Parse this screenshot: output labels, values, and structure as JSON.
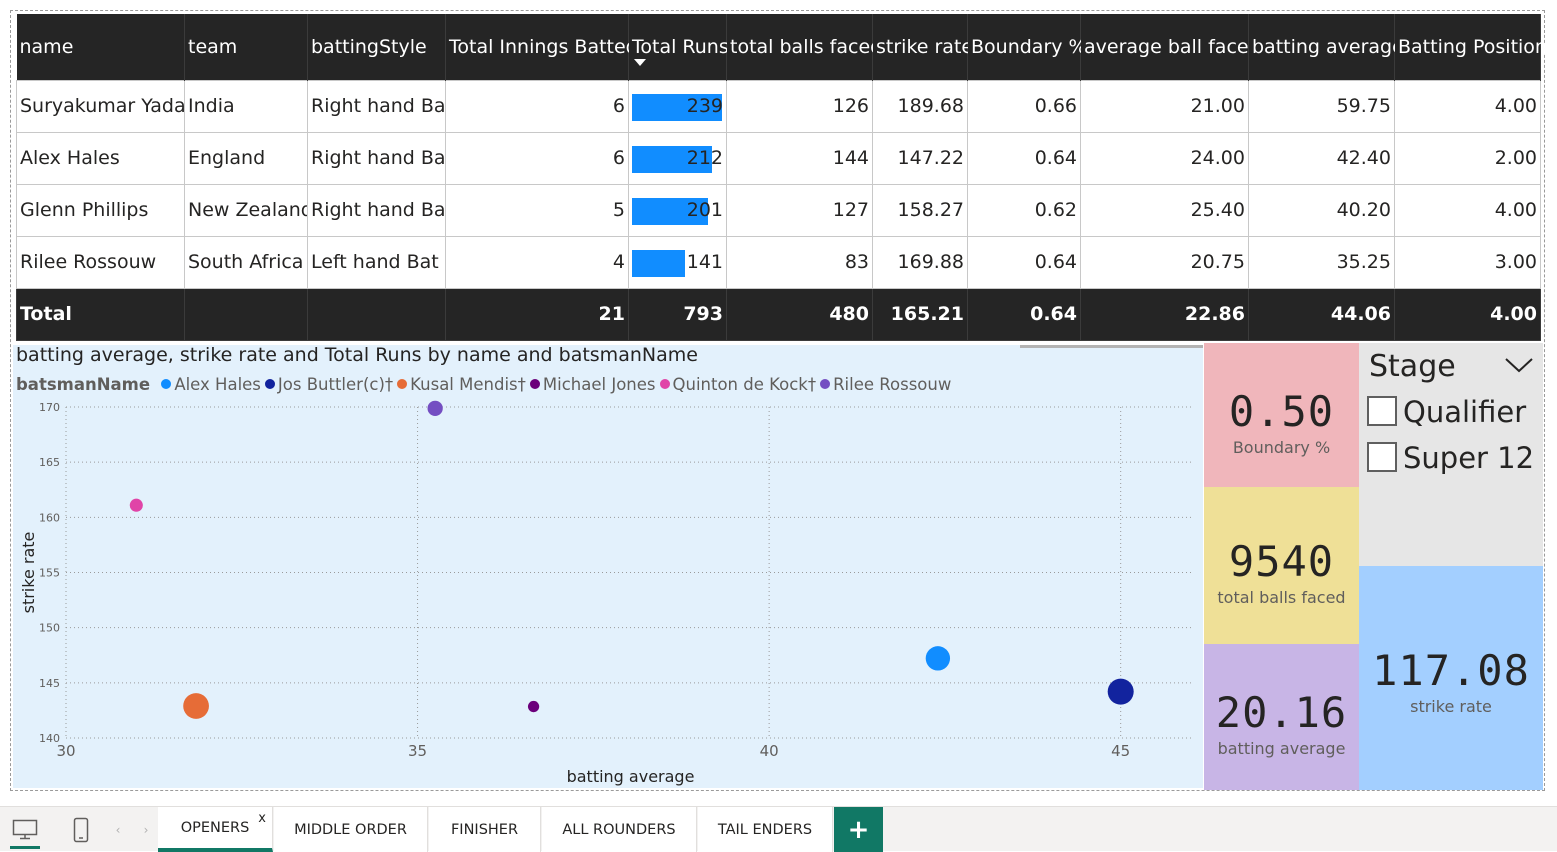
{
  "table": {
    "columns": [
      "name",
      "team",
      "battingStyle",
      "Total Innings Batted",
      "Total Runs",
      "total balls faced",
      "strike rate",
      "Boundary %",
      "average ball faced",
      "batting average",
      "Batting Position"
    ],
    "rows": [
      {
        "name": "Suryakumar Yadav",
        "team": "India",
        "style": "Right hand Bat",
        "innings": "6",
        "runs": "239",
        "balls": "126",
        "sr": "189.68",
        "boundary": "0.66",
        "avg_ball": "21.00",
        "bat_avg": "59.75",
        "pos": "4.00",
        "runs_value": 239
      },
      {
        "name": "Alex Hales",
        "team": "England",
        "style": "Right hand Bat",
        "innings": "6",
        "runs": "212",
        "balls": "144",
        "sr": "147.22",
        "boundary": "0.64",
        "avg_ball": "24.00",
        "bat_avg": "42.40",
        "pos": "2.00",
        "runs_value": 212
      },
      {
        "name": "Glenn Phillips",
        "team": "New Zealand",
        "style": "Right hand Bat",
        "innings": "5",
        "runs": "201",
        "balls": "127",
        "sr": "158.27",
        "boundary": "0.62",
        "avg_ball": "25.40",
        "bat_avg": "40.20",
        "pos": "4.00",
        "runs_value": 201
      },
      {
        "name": "Rilee Rossouw",
        "team": "South Africa",
        "style": "Left hand Bat",
        "innings": "4",
        "runs": "141",
        "balls": "83",
        "sr": "169.88",
        "boundary": "0.64",
        "avg_ball": "20.75",
        "bat_avg": "35.25",
        "pos": "3.00",
        "runs_value": 141
      }
    ],
    "total": {
      "label": "Total",
      "innings": "21",
      "runs": "793",
      "balls": "480",
      "sr": "165.21",
      "boundary": "0.64",
      "avg_ball": "22.86",
      "bat_avg": "44.06",
      "pos": "4.00"
    },
    "bar_max": 239,
    "bar_color": "#118dff"
  },
  "chart_data": {
    "type": "scatter",
    "title": "batting average, strike rate and Total Runs by name and batsmanName",
    "legend_title": "batsmanName",
    "xlabel": "batting average",
    "ylabel": "strike rate",
    "xlim": [
      30,
      46
    ],
    "ylim": [
      140,
      170
    ],
    "x_ticks": [
      30,
      35,
      40,
      45
    ],
    "y_ticks": [
      140,
      145,
      150,
      155,
      160,
      165,
      170
    ],
    "grid": true,
    "legend_position": "top-left",
    "series": [
      {
        "name": "Alex Hales",
        "color": "#118dff",
        "x": 42.4,
        "y": 147.22,
        "size": 212
      },
      {
        "name": "Jos Buttler(c)†",
        "color": "#12239e",
        "x": 45.0,
        "y": 144.2,
        "size": 225
      },
      {
        "name": "Kusal Mendis†",
        "color": "#e66c37",
        "x": 31.85,
        "y": 142.9,
        "size": 223
      },
      {
        "name": "Michael Jones",
        "color": "#6b007b",
        "x": 36.65,
        "y": 142.85,
        "size": 110
      },
      {
        "name": "Quinton de Kock†",
        "color": "#e044a7",
        "x": 31.0,
        "y": 161.1,
        "size": 124
      },
      {
        "name": "Rilee Rossouw",
        "color": "#744ec2",
        "x": 35.25,
        "y": 169.88,
        "size": 141
      }
    ]
  },
  "cards": {
    "boundary": {
      "value": "0.50",
      "label": "Boundary %",
      "color": "#f0b6bb"
    },
    "balls": {
      "value": "9540",
      "label": "total balls faced",
      "color": "#efe097"
    },
    "avg": {
      "value": "20.16",
      "label": "batting average",
      "color": "#c8b5e6"
    },
    "sr": {
      "value": "117.08",
      "label": "strike rate",
      "color": "#a3cfff"
    }
  },
  "slicer": {
    "title": "Stage",
    "options": [
      "Qualifier",
      "Super 12"
    ]
  },
  "tabs": {
    "items": [
      "OPENERS",
      "MIDDLE ORDER",
      "FINISHER",
      "ALL ROUNDERS",
      "TAIL ENDERS"
    ],
    "active": "OPENERS",
    "close_glyph": "x",
    "add_glyph": "+",
    "accent": "#117865"
  },
  "icons": {
    "desktop": "desktop-icon",
    "phone": "phone-icon",
    "nav_left": "‹",
    "nav_right": "›"
  }
}
